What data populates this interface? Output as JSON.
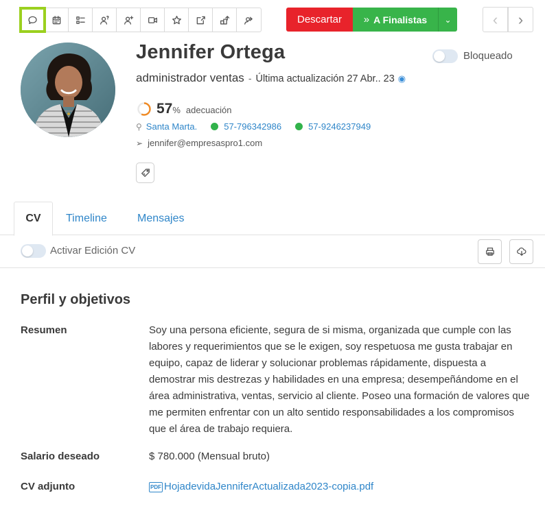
{
  "toolbar": {
    "icons": [
      "chat-icon",
      "calendar-icon",
      "checklist-icon",
      "user-question-icon",
      "user-add-icon",
      "video-icon",
      "star-icon",
      "edit-icon",
      "transfer-icon",
      "user-share-icon"
    ]
  },
  "actions": {
    "discard_label": "Descartar",
    "finalist_label": "A Finalistas",
    "colors": {
      "discard": "#e8232b",
      "finalist": "#38b44a",
      "highlight": "#9bd01f",
      "link": "#2f86c9"
    }
  },
  "candidate": {
    "name": "Jennifer Ortega",
    "role": "administrador ventas",
    "separator": "-",
    "updated": "Última actualización 27 Abr.. 23",
    "match_value": "57",
    "match_percent": 57,
    "match_sign": "%",
    "match_label": "adecuación",
    "city": "Santa Marta.",
    "phone1": "57-796342986",
    "phone2": "57-9246237949",
    "email": "jennifer@empresaspro1.com",
    "blocked_label": "Bloqueado"
  },
  "tabs": [
    {
      "label": "CV"
    },
    {
      "label": "Timeline"
    },
    {
      "label": "Mensajes"
    }
  ],
  "cv": {
    "edit_toggle_label": "Activar Edición CV",
    "section_title": "Perfil y objetivos",
    "summary_label": "Resumen",
    "summary_text": "Soy una persona eficiente, segura de si misma, organizada que cumple con las labores y requerimientos que se le exigen, soy respetuosa me gusta trabajar en equipo, capaz de liderar y solucionar problemas rápidamente, dispuesta a demostrar mis destrezas y habilidades en una empresa; desempeñándome en el área administrativa, ventas, servicio al cliente. Poseo una formación de valores que me permiten enfrentar con un alto sentido responsabilidades a los compromisos que el área de trabajo requiera.",
    "salary_label": "Salario deseado",
    "salary_value": "$ 780.000 (Mensual bruto)",
    "attachment_label": "CV adjunto",
    "attachment_name": "HojadevidaJenniferActualizada2023-copia.pdf"
  }
}
